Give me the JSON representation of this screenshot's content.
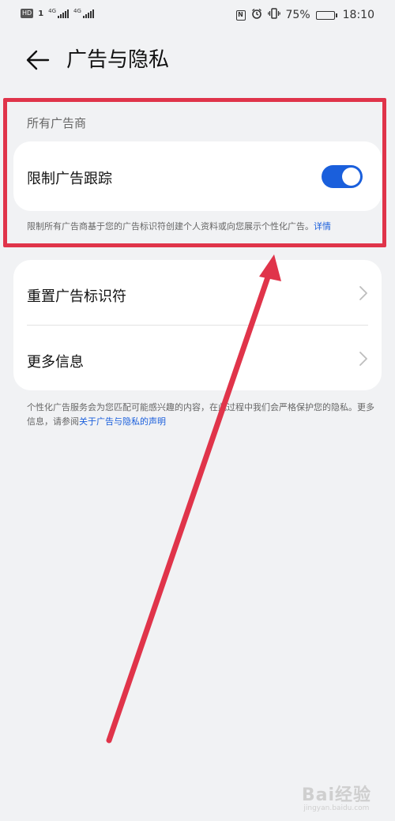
{
  "status_bar": {
    "hd_badge": "HD",
    "sim_number": "1",
    "signal1_label": "4G",
    "signal2_label": "4G",
    "nfc_icon_text": "N",
    "battery_percent_text": "75%",
    "battery_level": 0.75,
    "time": "18:10"
  },
  "header": {
    "title": "广告与隐私"
  },
  "section": {
    "label": "所有广告商",
    "toggle_row": {
      "label": "限制广告跟踪",
      "toggle_on": true
    },
    "note_text": "限制所有广告商基于您的广告标识符创建个人资料或向您展示个性化广告。",
    "note_link": "详情"
  },
  "list": {
    "items": [
      {
        "label": "重置广告标识符"
      },
      {
        "label": "更多信息"
      }
    ]
  },
  "footer_note": {
    "text": "个性化广告服务会为您匹配可能感兴趣的内容，在此过程中我们会严格保护您的隐私。更多信息，请参阅",
    "link": "关于广告与隐私的声明"
  },
  "colors": {
    "accent": "#1a5fdc",
    "annotation": "#e0344a",
    "background": "#f1f2f4"
  },
  "watermark": {
    "main": "Bai经验",
    "sub": "jingyan.baidu.com"
  }
}
